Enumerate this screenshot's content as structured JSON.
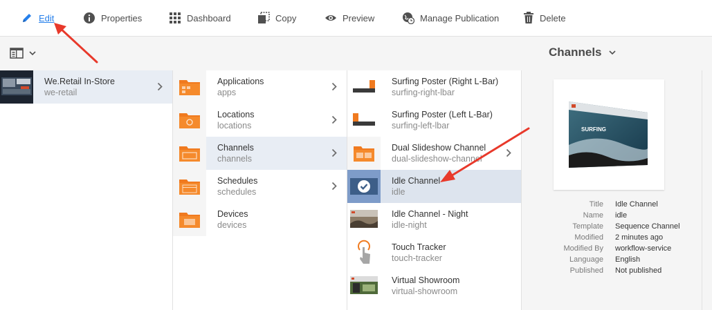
{
  "toolbar": {
    "edit": "Edit",
    "properties": "Properties",
    "dashboard": "Dashboard",
    "copy": "Copy",
    "preview": "Preview",
    "manage_publication": "Manage Publication",
    "delete": "Delete"
  },
  "header": {
    "title": "Channels"
  },
  "column1": [
    {
      "title": "We.Retail In-Store",
      "name": "we-retail"
    }
  ],
  "column2": [
    {
      "title": "Applications",
      "name": "apps"
    },
    {
      "title": "Locations",
      "name": "locations"
    },
    {
      "title": "Channels",
      "name": "channels"
    },
    {
      "title": "Schedules",
      "name": "schedules"
    },
    {
      "title": "Devices",
      "name": "devices"
    }
  ],
  "column3": [
    {
      "title": "Surfing Poster (Right L-Bar)",
      "name": "surfing-right-lbar"
    },
    {
      "title": "Surfing Poster (Left L-Bar)",
      "name": "surfing-left-lbar"
    },
    {
      "title": "Dual Slideshow Channel",
      "name": "dual-slideshow-channel"
    },
    {
      "title": "Idle Channel",
      "name": "idle"
    },
    {
      "title": "Idle Channel - Night",
      "name": "idle-night"
    },
    {
      "title": "Touch Tracker",
      "name": "touch-tracker"
    },
    {
      "title": "Virtual Showroom",
      "name": "virtual-showroom"
    }
  ],
  "details": {
    "preview_text": "SURFING",
    "rows": [
      {
        "key": "Title",
        "value": "Idle Channel"
      },
      {
        "key": "Name",
        "value": "idle"
      },
      {
        "key": "Template",
        "value": "Sequence Channel"
      },
      {
        "key": "Modified",
        "value": "2 minutes ago"
      },
      {
        "key": "Modified By",
        "value": "workflow-service"
      },
      {
        "key": "Language",
        "value": "English"
      },
      {
        "key": "Published",
        "value": "Not published"
      }
    ]
  },
  "colors": {
    "accent": "#2680eb",
    "folder": "#f07a1f",
    "arrow": "#e8392b"
  }
}
